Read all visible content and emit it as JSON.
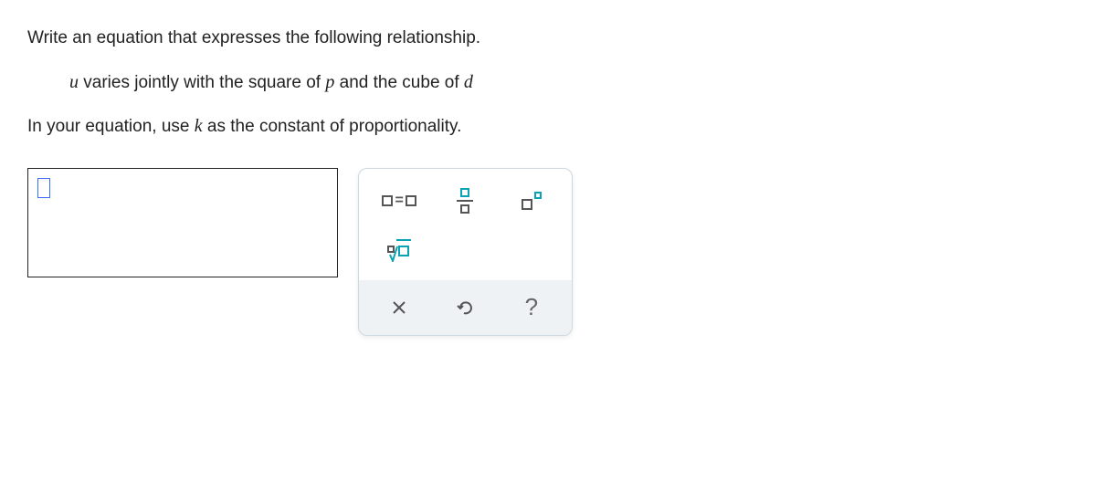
{
  "question": {
    "line1": "Write an equation that expresses the following relationship.",
    "line2_pre": " varies jointly with the square of ",
    "line2_mid": " and the cube of ",
    "line3_pre": "In your equation, use ",
    "line3_post": " as the constant of proportionality.",
    "var_u": "u",
    "var_p": "p",
    "var_d": "d",
    "var_k": "k"
  },
  "toolbox": {
    "equation": "equation",
    "fraction": "fraction",
    "exponent": "exponent",
    "root": "nth-root",
    "clear": "clear",
    "undo": "undo",
    "help": "?"
  }
}
